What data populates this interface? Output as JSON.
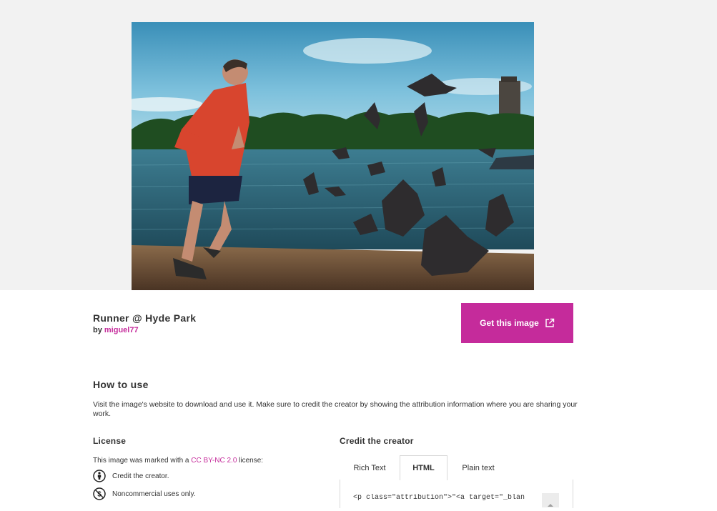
{
  "image": {
    "title": "Runner @ Hyde Park",
    "by_prefix": "by",
    "creator": "miguel77"
  },
  "actions": {
    "get_image_label": "Get this image"
  },
  "how_to_use": {
    "heading": "How to use",
    "text": "Visit the image's website to download and use it. Make sure to credit the creator by showing the attribution information where you are sharing your work."
  },
  "license": {
    "heading": "License",
    "text_before": "This image was marked with a",
    "license_name": "CC BY-NC 2.0",
    "text_after": "license:",
    "items": [
      {
        "icon": "by-attribution-icon",
        "label": "Credit the creator."
      },
      {
        "icon": "noncommercial-icon",
        "label": "Noncommercial uses only."
      }
    ]
  },
  "credit": {
    "heading": "Credit the creator",
    "tabs": [
      "Rich Text",
      "HTML",
      "Plain text"
    ],
    "active_tab": "HTML",
    "code": "<p class=\"attribution\">\"<a target=\"_blan"
  },
  "colors": {
    "accent": "#c52b9b",
    "hero_bg": "#f2f2f2",
    "text": "#333333"
  }
}
